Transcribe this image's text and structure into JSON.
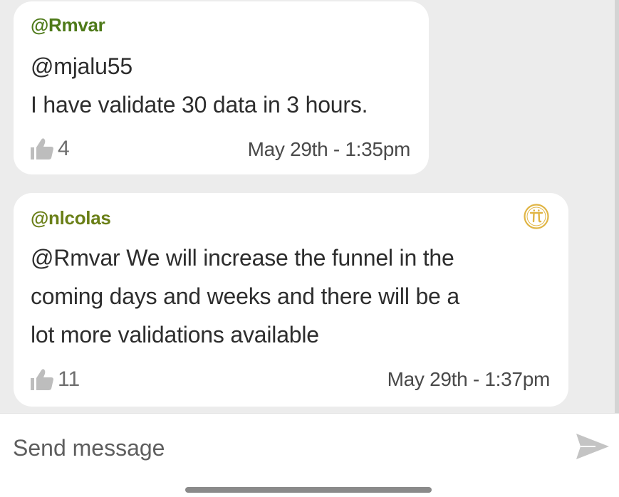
{
  "messages": [
    {
      "author": "@Rmvar",
      "lines": [
        "@mjalu55",
        "I have validate 30 data in 3 hours."
      ],
      "likes": "4",
      "timestamp": "May 29th - 1:35pm"
    },
    {
      "author": "@nlcolas",
      "lines": [
        "@Rmvar We will increase the funnel in the",
        "coming days and weeks and there will be a",
        "lot more validations available"
      ],
      "likes": "11",
      "timestamp": "May 29th - 1:37pm",
      "badge_icon": "pi-core-team-badge-icon"
    }
  ],
  "composer": {
    "placeholder": "Send message",
    "send_icon": "send-icon"
  },
  "colors": {
    "background": "#ececec",
    "bubble": "#ffffff",
    "author_1": "#4e7a19",
    "author_2": "#6a7f17",
    "badge": "#e0b545"
  }
}
